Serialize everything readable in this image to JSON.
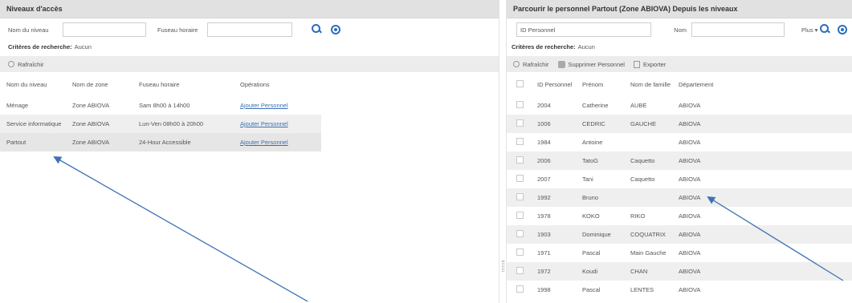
{
  "left": {
    "title": "Niveaux d'accès",
    "search": {
      "level_name_label": "Nom du niveau",
      "level_name_value": "",
      "timezone_label": "Fuseau horaire",
      "timezone_value": ""
    },
    "criteria_label": "Critères de recherche:",
    "criteria_value": "Aucun",
    "toolbar": {
      "refresh": "Rafraîchir"
    },
    "columns": [
      "Nom du niveau",
      "Nom de zone",
      "Fuseau horaire",
      "Opérations"
    ],
    "rows": [
      {
        "level": "Ménage",
        "zone": "Zone ABIOVA",
        "timezone": "Sam 8h00 à 14h00",
        "operation": "Ajouter Personnel"
      },
      {
        "level": "Service informatique",
        "zone": "Zone ABIOVA",
        "timezone": "Lun-Ven 08h00 à 20h00",
        "operation": "Ajouter Personnel"
      },
      {
        "level": "Partout",
        "zone": "Zone ABIOVA",
        "timezone": "24-Hour Accessible",
        "operation": "Ajouter Personnel"
      }
    ]
  },
  "right": {
    "title": "Parcourir le personnel Partout (Zone ABIOVA) Depuis les niveaux",
    "search": {
      "id_label": "ID Personnel",
      "id_value": "",
      "name_label": "Nom",
      "name_value": "",
      "more_label": "Plus ▾"
    },
    "criteria_label": "Critères de recherche:",
    "criteria_value": "Aucun",
    "toolbar": {
      "refresh": "Rafraîchir",
      "delete": "Supprimer Personnel",
      "export": "Exporter"
    },
    "columns": [
      "ID Personnel",
      "Prénom",
      "Nom de famille",
      "Département"
    ],
    "rows": [
      {
        "id": "2004",
        "first": "Catherine",
        "last": "AUBE",
        "dept": "ABIOVA"
      },
      {
        "id": "1006",
        "first": "CEDRIC",
        "last": "GAUCHE",
        "dept": "ABIOVA"
      },
      {
        "id": "1984",
        "first": "Antoine",
        "last": "",
        "dept": "ABIOVA"
      },
      {
        "id": "2006",
        "first": "TatoG",
        "last": "Caquetto",
        "dept": "ABIOVA"
      },
      {
        "id": "2007",
        "first": "Tani",
        "last": "Caquetto",
        "dept": "ABIOVA"
      },
      {
        "id": "1992",
        "first": "Bruno",
        "last": "",
        "dept": "ABIOVA"
      },
      {
        "id": "1978",
        "first": "KOKO",
        "last": "RIKO",
        "dept": "ABIOVA"
      },
      {
        "id": "1903",
        "first": "Dominique",
        "last": "COQUATRIX",
        "dept": "ABIOVA"
      },
      {
        "id": "1971",
        "first": "Pascal",
        "last": "Main Gauche",
        "dept": "ABIOVA"
      },
      {
        "id": "1972",
        "first": "Koudi",
        "last": "CHAN",
        "dept": "ABIOVA"
      },
      {
        "id": "1998",
        "first": "Pascal",
        "last": "LENTES",
        "dept": "ABIOVA"
      }
    ]
  },
  "colors": {
    "accent": "#2a6ebb",
    "arrow": "#3f72b4"
  }
}
